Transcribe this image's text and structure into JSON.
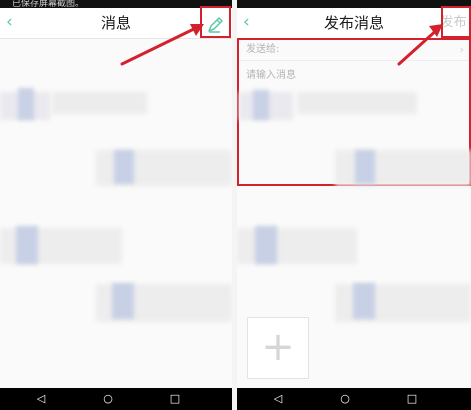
{
  "left": {
    "status_text": "已保存屏幕截图。",
    "title": "消息",
    "back_icon": "‹",
    "compose_icon": "pencil-icon"
  },
  "right": {
    "title": "发布消息",
    "back_icon": "‹",
    "publish_label": "发布",
    "send_to_label": "发送给:",
    "message_placeholder": "请输入消息",
    "chevron": "›",
    "add_icon": "+"
  },
  "nav": {
    "back": "◁",
    "home": "○",
    "recents": "□"
  },
  "colors": {
    "accent": "#5fc8a6",
    "highlight": "#d3212e",
    "nav_background": "#000000"
  }
}
